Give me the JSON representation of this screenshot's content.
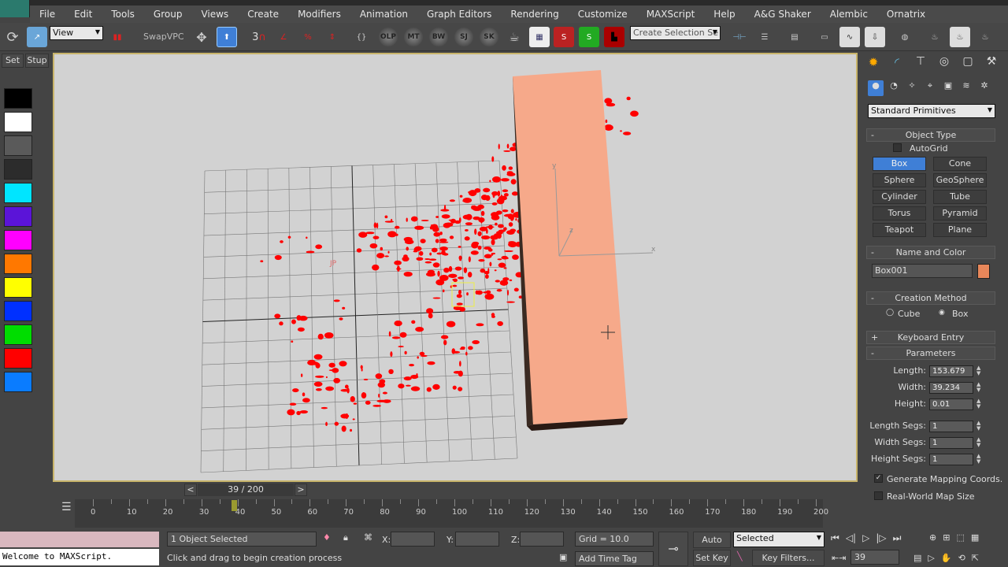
{
  "menu": [
    "File",
    "Edit",
    "Tools",
    "Group",
    "Views",
    "Create",
    "Modifiers",
    "Animation",
    "Graph Editors",
    "Rendering",
    "Customize",
    "MAXScript",
    "Help",
    "A&G Shaker",
    "Alembic",
    "Ornatrix"
  ],
  "toolbar": {
    "reference_coord": "View",
    "swap_label": "SwapVPC",
    "snap_3": "3",
    "circle_buttons": [
      "OLP",
      "MT",
      "BW",
      "SJ",
      "SK"
    ],
    "selection_set_placeholder": "Create Selection Se"
  },
  "leftbar": {
    "set": "Set",
    "stup": "Stup",
    "swatches": [
      "#000000",
      "#ffffff",
      "#5a5a5a",
      "#2c2c2c",
      "#00e5ff",
      "#5b14d8",
      "#ff00ff",
      "#ff7800",
      "#ffff00",
      "#0030ff",
      "#00dd00",
      "#ff0000",
      "#0a7cff"
    ]
  },
  "viewport": {
    "box_color": "#f6a98a",
    "splatter_color": "#ff0000",
    "gizmo_labels": {
      "y": "y",
      "z": "z",
      "x": "x"
    },
    "plane_label": "JP"
  },
  "cmdpanel": {
    "category": "Standard Primitives",
    "object_type": {
      "title": "Object Type",
      "autogrid": "AutoGrid",
      "autogrid_checked": false,
      "buttons": [
        "Box",
        "Cone",
        "Sphere",
        "GeoSphere",
        "Cylinder",
        "Tube",
        "Torus",
        "Pyramid",
        "Teapot",
        "Plane"
      ],
      "selected": "Box"
    },
    "name_color": {
      "title": "Name and Color",
      "name": "Box001",
      "color": "#e8875a"
    },
    "creation_method": {
      "title": "Creation Method",
      "cube": "Cube",
      "box": "Box",
      "selected": "Box"
    },
    "keyboard_entry": {
      "title": "Keyboard Entry"
    },
    "parameters": {
      "title": "Parameters",
      "fields": [
        {
          "label": "Length:",
          "value": "153.679"
        },
        {
          "label": "Width:",
          "value": "39.234"
        },
        {
          "label": "Height:",
          "value": "0.01"
        },
        {
          "label": "Length Segs:",
          "value": "1"
        },
        {
          "label": "Width Segs:",
          "value": "1"
        },
        {
          "label": "Height Segs:",
          "value": "1"
        }
      ],
      "gen_mapping": "Generate Mapping Coords.",
      "gen_mapping_checked": true,
      "real_world": "Real-World Map Size",
      "real_world_checked": false
    }
  },
  "timeline": {
    "frame_label": "39 / 200",
    "current": 39,
    "total": 200,
    "ticks": [
      "0",
      "10",
      "20",
      "30",
      "40",
      "50",
      "60",
      "70",
      "80",
      "90",
      "100",
      "110",
      "120",
      "130",
      "140",
      "150",
      "160",
      "170",
      "180",
      "190",
      "200"
    ]
  },
  "status": {
    "listener_text": "Welcome to MAXScript.",
    "selected": "1 Object Selected",
    "prompt": "Click and drag to begin creation process",
    "x_label": "X:",
    "y_label": "Y:",
    "z_label": "Z:",
    "grid": "Grid = 10.0",
    "add_time_tag": "Add Time Tag",
    "auto_key": "Auto Key",
    "set_key": "Set Key",
    "key_mode": "Selected",
    "key_filters": "Key Filters...",
    "frame": "39"
  }
}
